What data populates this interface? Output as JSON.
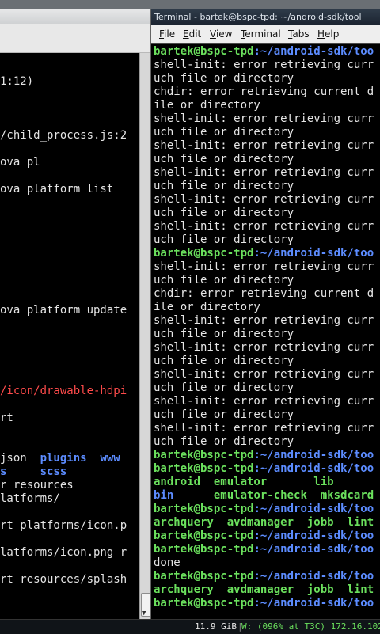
{
  "colors": {
    "prompt_green": "#6be05d",
    "path_blue": "#5c8cff",
    "error_red": "#ff4b4b",
    "text": "#e6e6e6"
  },
  "left_terminal": {
    "lines": [
      {
        "text": "1:12)",
        "style": "normal"
      },
      {
        "text": "",
        "style": "normal"
      },
      {
        "text": "",
        "style": "normal"
      },
      {
        "text": "",
        "style": "normal"
      },
      {
        "text": "/child_process.js:2",
        "style": "normal"
      },
      {
        "text": "",
        "style": "normal"
      },
      {
        "text": "ova pl",
        "style": "normal"
      },
      {
        "text": "",
        "style": "normal"
      },
      {
        "text": "ova platform list",
        "style": "normal"
      },
      {
        "text": "",
        "style": "normal"
      },
      {
        "text": "",
        "style": "normal"
      },
      {
        "text": "",
        "style": "normal"
      },
      {
        "text": "",
        "style": "normal"
      },
      {
        "text": "",
        "style": "normal"
      },
      {
        "text": "",
        "style": "normal"
      },
      {
        "text": "",
        "style": "normal"
      },
      {
        "text": "",
        "style": "normal"
      },
      {
        "text": "ova platform update",
        "style": "normal"
      },
      {
        "text": "",
        "style": "normal"
      },
      {
        "text": "",
        "style": "normal"
      },
      {
        "text": "",
        "style": "normal"
      },
      {
        "text": "",
        "style": "normal"
      },
      {
        "text": "",
        "style": "normal"
      },
      {
        "text": "/icon/drawable-hdpi",
        "style": "red"
      },
      {
        "text": "",
        "style": "normal"
      },
      {
        "text": "rt",
        "style": "normal"
      },
      {
        "text": "",
        "style": "normal"
      },
      {
        "text": "",
        "style": "normal"
      },
      {
        "text": "json  plugins  www",
        "style": "mixed_json"
      },
      {
        "text": "s     scss",
        "style": "blue"
      },
      {
        "text": "r resources",
        "style": "normal"
      },
      {
        "text": "latforms/",
        "style": "normal"
      },
      {
        "text": "",
        "style": "normal"
      },
      {
        "text": "rt platforms/icon.p",
        "style": "normal"
      },
      {
        "text": "",
        "style": "normal"
      },
      {
        "text": "latforms/icon.png r",
        "style": "normal"
      },
      {
        "text": "",
        "style": "normal"
      },
      {
        "text": "rt resources/splash",
        "style": "normal"
      }
    ]
  },
  "right_terminal": {
    "title": "Terminal - bartek@bspc-tpd: ~/android-sdk/tool",
    "menu": [
      {
        "label": "File",
        "u": "F",
        "rest": "ile"
      },
      {
        "label": "Edit",
        "u": "E",
        "rest": "dit"
      },
      {
        "label": "View",
        "u": "V",
        "rest": "iew"
      },
      {
        "label": "Terminal",
        "u": "T",
        "rest": "erminal"
      },
      {
        "label": "Tabs",
        "u": "T",
        "rest": "abs"
      },
      {
        "label": "Help",
        "u": "H",
        "rest": "elp"
      }
    ],
    "prompt_user": "bartek@bspc-tpd",
    "prompt_path": ":~/android-sdk/too",
    "lines": [
      {
        "kind": "prompt"
      },
      {
        "kind": "text",
        "text": "shell-init: error retrieving curr"
      },
      {
        "kind": "text",
        "text": "uch file or directory"
      },
      {
        "kind": "text",
        "text": "chdir: error retrieving current d"
      },
      {
        "kind": "text",
        "text": "ile or directory"
      },
      {
        "kind": "text",
        "text": "shell-init: error retrieving curr"
      },
      {
        "kind": "text",
        "text": "uch file or directory"
      },
      {
        "kind": "text",
        "text": "shell-init: error retrieving curr"
      },
      {
        "kind": "text",
        "text": "uch file or directory"
      },
      {
        "kind": "text",
        "text": "shell-init: error retrieving curr"
      },
      {
        "kind": "text",
        "text": "uch file or directory"
      },
      {
        "kind": "text",
        "text": "shell-init: error retrieving curr"
      },
      {
        "kind": "text",
        "text": "uch file or directory"
      },
      {
        "kind": "text",
        "text": "shell-init: error retrieving curr"
      },
      {
        "kind": "text",
        "text": "uch file or directory"
      },
      {
        "kind": "prompt"
      },
      {
        "kind": "text",
        "text": "shell-init: error retrieving curr"
      },
      {
        "kind": "text",
        "text": "uch file or directory"
      },
      {
        "kind": "text",
        "text": "chdir: error retrieving current d"
      },
      {
        "kind": "text",
        "text": "ile or directory"
      },
      {
        "kind": "text",
        "text": "shell-init: error retrieving curr"
      },
      {
        "kind": "text",
        "text": "uch file or directory"
      },
      {
        "kind": "text",
        "text": "shell-init: error retrieving curr"
      },
      {
        "kind": "text",
        "text": "uch file or directory"
      },
      {
        "kind": "text",
        "text": "shell-init: error retrieving curr"
      },
      {
        "kind": "text",
        "text": "uch file or directory"
      },
      {
        "kind": "text",
        "text": "shell-init: error retrieving curr"
      },
      {
        "kind": "text",
        "text": "uch file or directory"
      },
      {
        "kind": "text",
        "text": "shell-init: error retrieving curr"
      },
      {
        "kind": "text",
        "text": "uch file or directory"
      },
      {
        "kind": "prompt"
      },
      {
        "kind": "prompt"
      },
      {
        "kind": "ls1",
        "text": "android  emulator       lib"
      },
      {
        "kind": "ls2",
        "text": "bin      emulator-check  mksdcard"
      },
      {
        "kind": "prompt"
      },
      {
        "kind": "ls3",
        "text": "archquery  avdmanager  jobb  lint"
      },
      {
        "kind": "prompt"
      },
      {
        "kind": "prompt"
      },
      {
        "kind": "text",
        "text": "done"
      },
      {
        "kind": "prompt"
      },
      {
        "kind": "ls3",
        "text": "archquery  avdmanager  jobb  lint"
      },
      {
        "kind": "prompt"
      }
    ]
  },
  "status_bar": {
    "memory": "11.9 GiB",
    "wifi_label": "W: (096% at T3C) 172.16.102.",
    "separator": "|"
  }
}
